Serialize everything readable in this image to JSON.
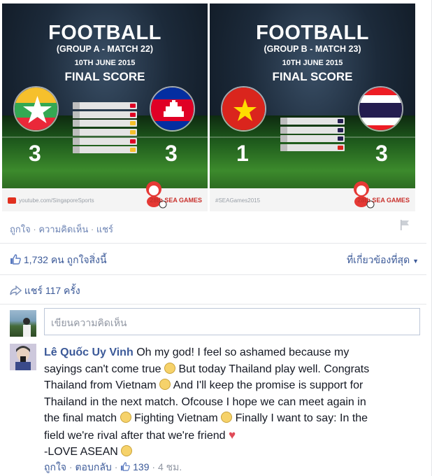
{
  "images": {
    "card_a": {
      "title": "FOOTBALL",
      "group": "(GROUP A - MATCH 22)",
      "date": "10TH JUNE 2015",
      "final_label": "FINAL SCORE",
      "left_score": "3",
      "right_score": "3",
      "footer": "youtube.com/SingaporeSports",
      "sea_games": "28th SEA GAMES"
    },
    "card_b": {
      "title": "FOOTBALL",
      "group": "(GROUP B - MATCH 23)",
      "date": "10TH JUNE 2015",
      "final_label": "FINAL SCORE",
      "left_score": "1",
      "right_score": "3",
      "footer": "#SEAGames2015",
      "sea_games": "28th SEA GAMES"
    }
  },
  "actions": {
    "like": "ถูกใจ",
    "comment": "ความคิดเห็น",
    "share": "แชร์",
    "separator": "·"
  },
  "likes": {
    "count": "1,732 คน",
    "text": "ถูกใจสิ่งนี้",
    "sort": "ที่เกี่ยวข้องที่สุด"
  },
  "shares": {
    "text": "แชร์ 117 ครั้ง"
  },
  "comment_input": {
    "placeholder": "เขียนความคิดเห็น"
  },
  "comment": {
    "author": "Lê Quốc Uy Vinh",
    "line1": "Oh my god! I feel so ashamed because my",
    "line2a": "sayings can't come true",
    "line2b": "But today Thailand play well. Congrats",
    "line3a": "Thailand from Vietnam",
    "line3b": "And I'll keep the promise is support for",
    "line4": "Thailand in the next match. Ofcouse I hope we can meet again in",
    "line5a": "the final match",
    "line5b": "Fighting Vietnam",
    "line5c": "Finally I want to say: In the",
    "line6": "field we're rival after that we're friend",
    "line7": "-LOVE ASEAN",
    "meta_like": "ถูกใจ",
    "meta_reply": "ตอบกลับ",
    "meta_likes": "139",
    "meta_time": "4 ชม."
  },
  "colors": {
    "link": "#3b5998",
    "muted": "#9197a3",
    "myanmar_yellow": "#f6c02c",
    "myanmar_green": "#34a853",
    "myanmar_red": "#ea2839",
    "cambodia_blue": "#032ea1",
    "cambodia_red": "#e00025",
    "vietnam_red": "#da251d",
    "thai_red": "#ed1c24",
    "thai_blue": "#241d4f"
  }
}
